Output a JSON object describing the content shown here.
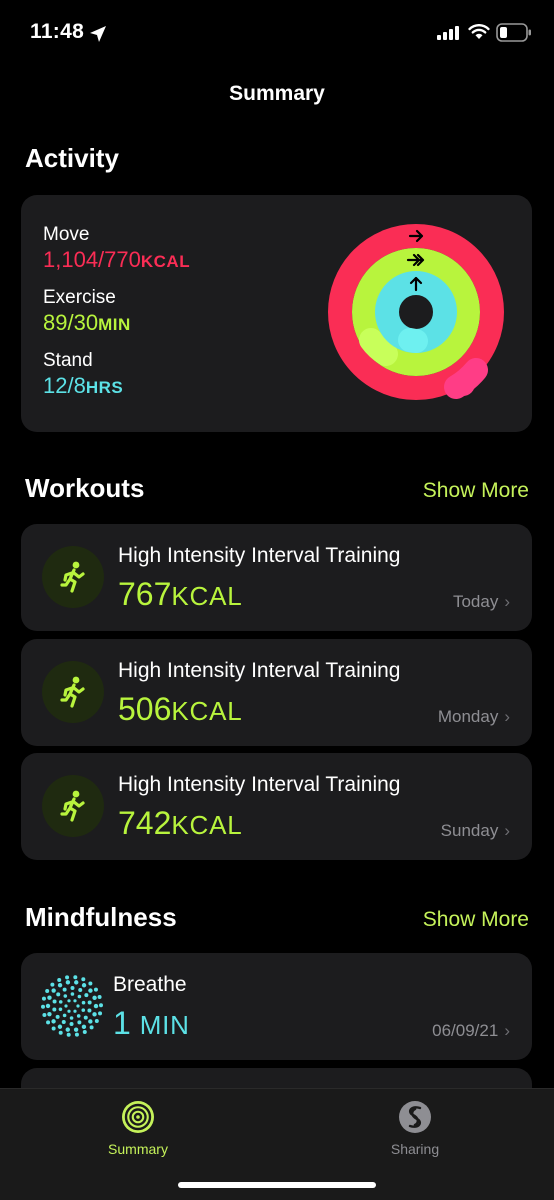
{
  "status_bar": {
    "time": "11:48"
  },
  "nav": {
    "title": "Summary"
  },
  "activity": {
    "section_title": "Activity",
    "move": {
      "label": "Move",
      "value": "1,104/770",
      "unit": "KCAL",
      "progress": 1.43
    },
    "exercise": {
      "label": "Exercise",
      "value": "89/30",
      "unit": "MIN",
      "progress": 2.97
    },
    "stand": {
      "label": "Stand",
      "value": "12/8",
      "unit": "HRS",
      "progress": 1.5
    }
  },
  "workouts": {
    "section_title": "Workouts",
    "show_more": "Show More",
    "items": [
      {
        "name": "High Intensity Interval Training",
        "value": "767",
        "unit": "KCAL",
        "date": "Today"
      },
      {
        "name": "High Intensity Interval Training",
        "value": "506",
        "unit": "KCAL",
        "date": "Monday"
      },
      {
        "name": "High Intensity Interval Training",
        "value": "742",
        "unit": "KCAL",
        "date": "Sunday"
      }
    ]
  },
  "mindfulness": {
    "section_title": "Mindfulness",
    "show_more": "Show More",
    "items": [
      {
        "name": "Breathe",
        "value": "1",
        "unit": "MIN",
        "date": "06/09/21"
      }
    ]
  },
  "tabs": [
    {
      "label": "Summary",
      "icon": "activity-rings-icon",
      "active": true
    },
    {
      "label": "Sharing",
      "icon": "sharing-icon",
      "active": false
    }
  ],
  "colors": {
    "move": "#fa2d55",
    "exercise": "#b8f43d",
    "stand": "#5ce1e6",
    "accent": "#c5f25a",
    "card": "#1c1c1e"
  }
}
